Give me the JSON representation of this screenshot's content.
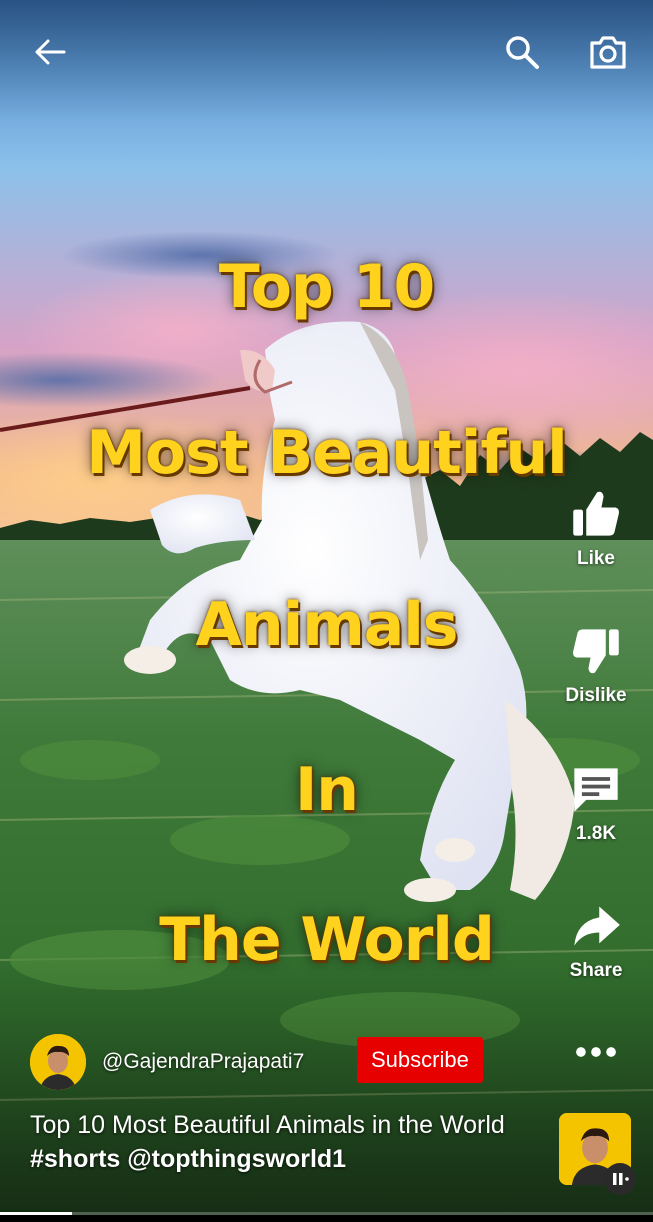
{
  "overlay": {
    "line1": "Top 10",
    "line2": "Most Beautiful",
    "line3": "Animals",
    "line4": "In",
    "line5": "The World"
  },
  "actions": {
    "like": "Like",
    "dislike": "Dislike",
    "comments": "1.8K",
    "share": "Share"
  },
  "channel": {
    "handle": "@GajendraPrajapati7",
    "subscribe": "Subscribe"
  },
  "caption": {
    "text": "Top 10 Most Beautiful Animals in the World ",
    "hashtag": "#shorts",
    "mention": "@topthingsworld1"
  },
  "progress": {
    "fraction": 0.11
  },
  "icons": {
    "back": "back-arrow-icon",
    "search": "search-icon",
    "camera": "camera-icon",
    "like": "thumbs-up-icon",
    "dislike": "thumbs-down-icon",
    "comment": "comment-icon",
    "share": "share-icon",
    "more": "more-icon",
    "pause": "pause-icon"
  },
  "colors": {
    "overlay_text": "#FFD21E",
    "subscribe_bg": "#E60000",
    "avatar_bg": "#F5C400"
  }
}
